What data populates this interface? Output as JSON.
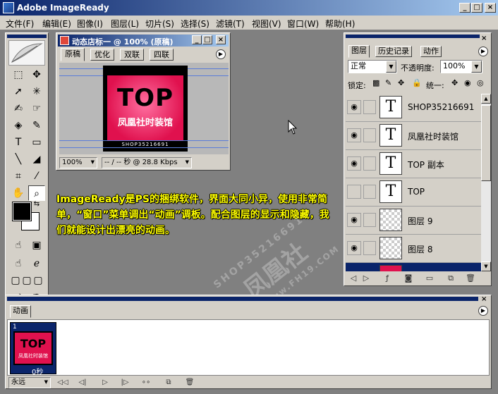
{
  "app": {
    "title": "Adobe ImageReady",
    "window_buttons": [
      "_",
      "□",
      "×"
    ]
  },
  "menu": [
    "文件(F)",
    "编辑(E)",
    "图像(I)",
    "图层(L)",
    "切片(S)",
    "选择(S)",
    "滤镜(T)",
    "视图(V)",
    "窗口(W)",
    "帮助(H)"
  ],
  "toolbox": {
    "tools": [
      "marquee",
      "move",
      "lasso",
      "magic-wand",
      "slice",
      "slice-select",
      "brush",
      "pencil",
      "eraser",
      "paint-bucket",
      "type",
      "rectangle",
      "line",
      "rounded-rect",
      "crop",
      "eyedropper",
      "hand",
      "zoom"
    ]
  },
  "document": {
    "title": "动态店标一 @ 100% (原稿)",
    "tabs": [
      "原稿",
      "优化",
      "双联",
      "四联"
    ],
    "selected_tab": "原稿",
    "zoom": "100%",
    "status": "-- / -- 秒 @ 28.8 Kbps",
    "artwork": {
      "title": "TOP",
      "subtitle": "凤凰社时装馆",
      "footer": "SHOP35216691"
    }
  },
  "caption": "ImageReady是PS的捆绑软件，界面大同小异，使用非常简单，“窗口”菜单调出“动画”调板。配合图层的显示和隐藏，我们就能设计出漂亮的动画。",
  "watermark": {
    "line1": "SHOP35216691",
    "line2": "凤凰社",
    "line3": "www.FH19.COM"
  },
  "layers_panel": {
    "tabs": [
      "图层",
      "历史记录",
      "动作"
    ],
    "selected_tab": "图层",
    "blend_mode": "正常",
    "opacity_label": "不透明度:",
    "opacity_value": "100%",
    "lock_label": "锁定:",
    "unify_label": "统一:",
    "layers": [
      {
        "name": "SHOP35216691",
        "type": "text",
        "visible": true
      },
      {
        "name": "凤凰社时装馆",
        "type": "text",
        "visible": true
      },
      {
        "name": "TOP 副本",
        "type": "text",
        "visible": true
      },
      {
        "name": "TOP",
        "type": "text",
        "visible": false
      },
      {
        "name": "图层 9",
        "type": "pixel",
        "visible": true
      },
      {
        "name": "图层 8",
        "type": "pixel",
        "visible": true
      }
    ]
  },
  "animation_panel": {
    "tab": "动画",
    "frames": [
      {
        "number": "1",
        "delay": "0秒",
        "thumb_title": "TOP",
        "thumb_subtitle": "凤凰社时装馆"
      }
    ],
    "loop": "永远"
  }
}
